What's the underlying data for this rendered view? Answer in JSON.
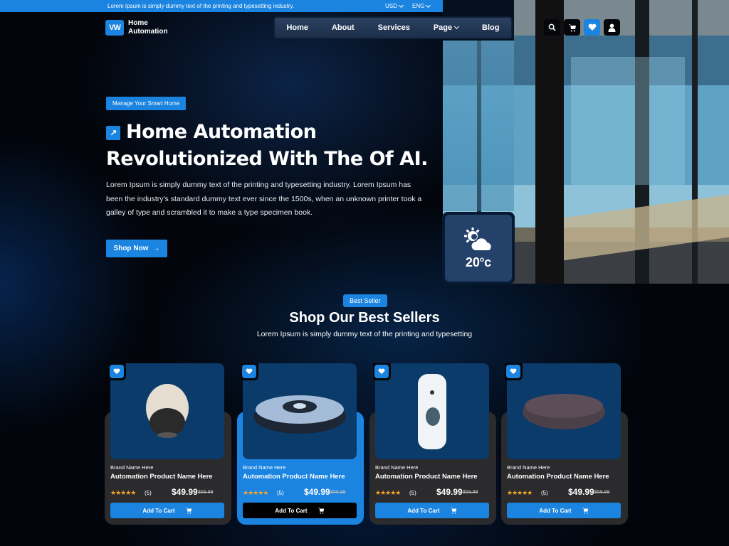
{
  "topbar": {
    "message": "Lorem Ipsum is simply dummy text of the printing and typesetting industry.",
    "currency": "USD",
    "language": "ENG"
  },
  "logo": {
    "mark": "VW",
    "line1": "Home",
    "line2": "Automation"
  },
  "nav": {
    "items": [
      "Home",
      "About",
      "Services",
      "Page",
      "Blog"
    ]
  },
  "header_icons": [
    "search-icon",
    "cart-icon",
    "heart-icon",
    "user-icon"
  ],
  "hero": {
    "tag": "Manage Your Smart Home",
    "title_line1": "Home Automation",
    "title_line2": "Revolutionized With The Of AI.",
    "paragraph": "Lorem Ipsum is simply dummy text of the printing and typesetting industry. Lorem Ipsum has been the industry's standard dummy text ever since the 1500s, when an unknown printer took a galley of type and scrambled it to make a type specimen book.",
    "button": "Shop Now",
    "arrow": "→"
  },
  "weather": {
    "temp": "20",
    "unit": "c",
    "degree": "o"
  },
  "section": {
    "badge": "Best Seller",
    "title": "Shop Our Best Sellers",
    "subtitle": "Lorem Ipsum is simply dummy text of the printing and typesetting"
  },
  "products": [
    {
      "image": "dome-camera",
      "brand": "Brand Name Here",
      "name": "Automation Product Name Here",
      "stars": "★★★★★",
      "rating": 5,
      "count": "(5)",
      "price": "$49.99",
      "old_price": "$59.99",
      "cart": "Add To Cart",
      "active": false
    },
    {
      "image": "robot-vacuum",
      "brand": "Brand Name Here",
      "name": "Automation Product Name Here",
      "stars": "★★★★★",
      "rating": 5,
      "count": "(5)",
      "price": "$49.99",
      "old_price": "$59.99",
      "cart": "Add To Cart",
      "active": true
    },
    {
      "image": "doorbell",
      "brand": "Brand Name Here",
      "name": "Automation Product Name Here",
      "stars": "★★★★★",
      "rating": 5,
      "count": "(5)",
      "price": "$49.99",
      "old_price": "$59.99",
      "cart": "Add To Cart",
      "active": false
    },
    {
      "image": "smart-speaker",
      "brand": "Brand Name Here",
      "name": "Automation Product Name Here",
      "stars": "★★★★★",
      "rating": 5,
      "count": "(5)",
      "price": "$49.99",
      "old_price": "$59.99",
      "cart": "Add To Cart",
      "active": false
    }
  ],
  "colors": {
    "accent": "#1a84e0",
    "card": "#2b2b2e",
    "image_bg": "#0b3b6b"
  }
}
